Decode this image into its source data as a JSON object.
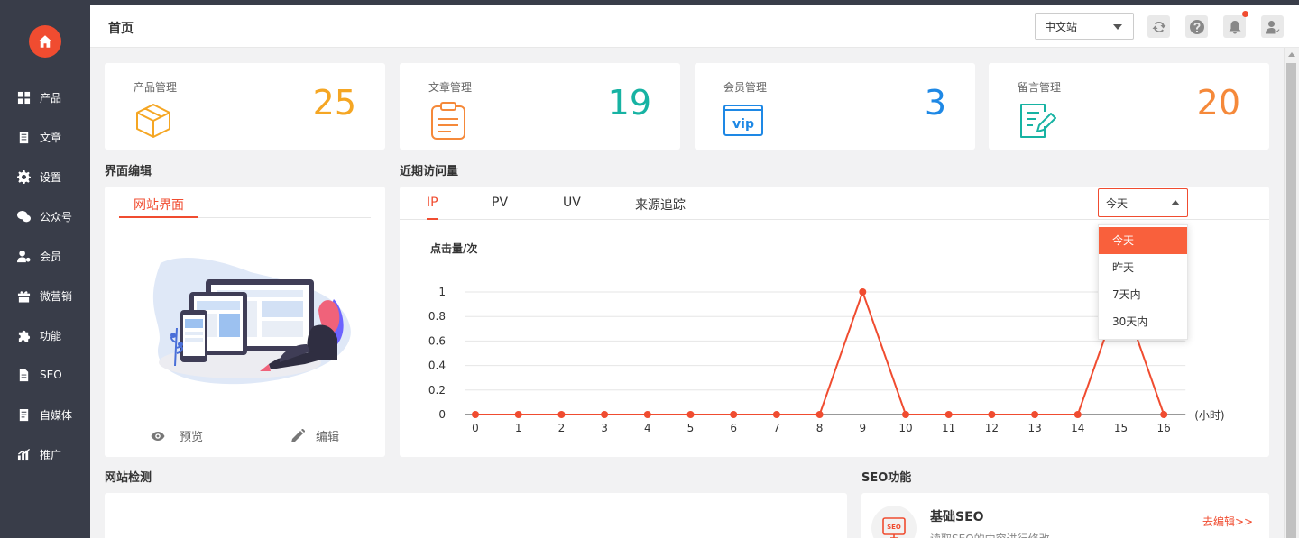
{
  "header": {
    "title": "首页",
    "site_select": "中文站",
    "icons": [
      "refresh-icon",
      "help-icon",
      "bell-icon",
      "user-icon"
    ]
  },
  "sidebar": {
    "items": [
      {
        "label": "产品",
        "icon": "grid-icon"
      },
      {
        "label": "文章",
        "icon": "document-icon"
      },
      {
        "label": "设置",
        "icon": "gear-icon"
      },
      {
        "label": "公众号",
        "icon": "wechat-icon"
      },
      {
        "label": "会员",
        "icon": "member-icon"
      },
      {
        "label": "微营销",
        "icon": "gift-icon"
      },
      {
        "label": "功能",
        "icon": "puzzle-icon"
      },
      {
        "label": "SEO",
        "icon": "seo-doc-icon"
      },
      {
        "label": "自媒体",
        "icon": "media-icon"
      },
      {
        "label": "推广",
        "icon": "chart-bar-icon"
      }
    ]
  },
  "stats": [
    {
      "label": "产品管理",
      "value": "25",
      "color": "#f5a623",
      "icon": "box-icon"
    },
    {
      "label": "文章管理",
      "value": "19",
      "color": "#17b3a3",
      "icon": "clipboard-icon"
    },
    {
      "label": "会员管理",
      "value": "3",
      "color": "#1e88e5",
      "icon": "vip-icon"
    },
    {
      "label": "留言管理",
      "value": "20",
      "color": "#f5893a",
      "icon": "note-edit-icon"
    }
  ],
  "editor": {
    "section_title": "界面编辑",
    "tab": "网站界面",
    "preview": "预览",
    "edit": "编辑"
  },
  "visits": {
    "section_title": "近期访问量",
    "tabs": [
      "IP",
      "PV",
      "UV",
      "来源追踪"
    ],
    "range": "今天",
    "range_options": [
      "今天",
      "昨天",
      "7天内",
      "30天内"
    ]
  },
  "chart_data": {
    "type": "line",
    "ylabel": "点击量/次",
    "xlabel": "(小时)",
    "x": [
      0,
      1,
      2,
      3,
      4,
      5,
      6,
      7,
      8,
      9,
      10,
      11,
      12,
      13,
      14,
      15,
      16
    ],
    "values": [
      0,
      0,
      0,
      0,
      0,
      0,
      0,
      0,
      0,
      1,
      0,
      0,
      0,
      0,
      0,
      1,
      0
    ],
    "yticks": [
      "0",
      "0.2",
      "0.4",
      "0.6",
      "0.8",
      "1"
    ],
    "ylim": [
      0,
      1
    ],
    "color": "#f04c30",
    "grid": true
  },
  "detect": {
    "section_title": "网站检测"
  },
  "seo": {
    "section_title": "SEO功能",
    "item_title": "基础SEO",
    "item_desc": "读取SEO的内容进行修改",
    "item_link": "去编辑>>",
    "icon_text": "SEO"
  }
}
